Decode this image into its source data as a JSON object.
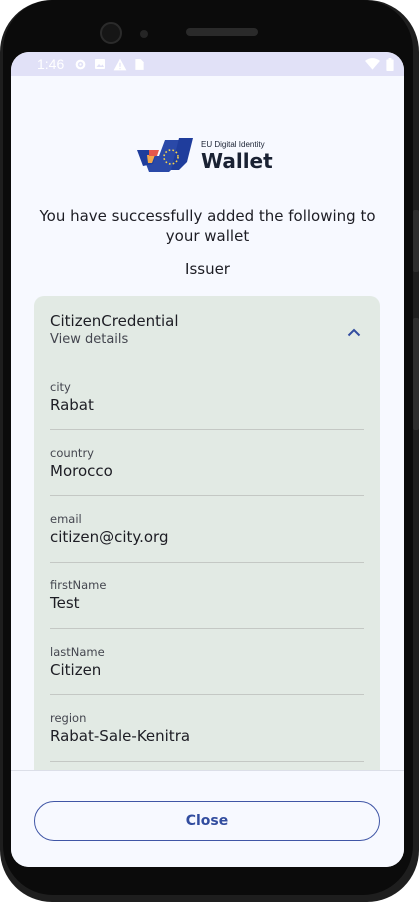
{
  "status_bar": {
    "time": "1:46",
    "left_icons": [
      "settings-icon",
      "image-icon",
      "warning-icon",
      "sim-card-icon"
    ],
    "right_icons": [
      "wifi-icon",
      "battery-icon"
    ]
  },
  "logo": {
    "small_text": "EU Digital Identity",
    "big_text": "Wallet"
  },
  "success_message": "You have successfully added the following to your wallet",
  "issuer_label": "Issuer",
  "credential": {
    "title": "CitizenCredential",
    "subtitle": "View details",
    "expanded": true,
    "fields": [
      {
        "label": "city",
        "value": "Rabat"
      },
      {
        "label": "country",
        "value": "Morocco"
      },
      {
        "label": "email",
        "value": "citizen@city.org"
      },
      {
        "label": "firstName",
        "value": "Test"
      },
      {
        "label": "lastName",
        "value": "Citizen"
      },
      {
        "label": "region",
        "value": "Rabat-Sale-Kenitra"
      }
    ]
  },
  "close_button": "Close",
  "colors": {
    "accent": "#324d9f",
    "card_background": "#e2eae4",
    "status_bar": "#e1e1f7",
    "screen_background": "#f7f9ff"
  }
}
